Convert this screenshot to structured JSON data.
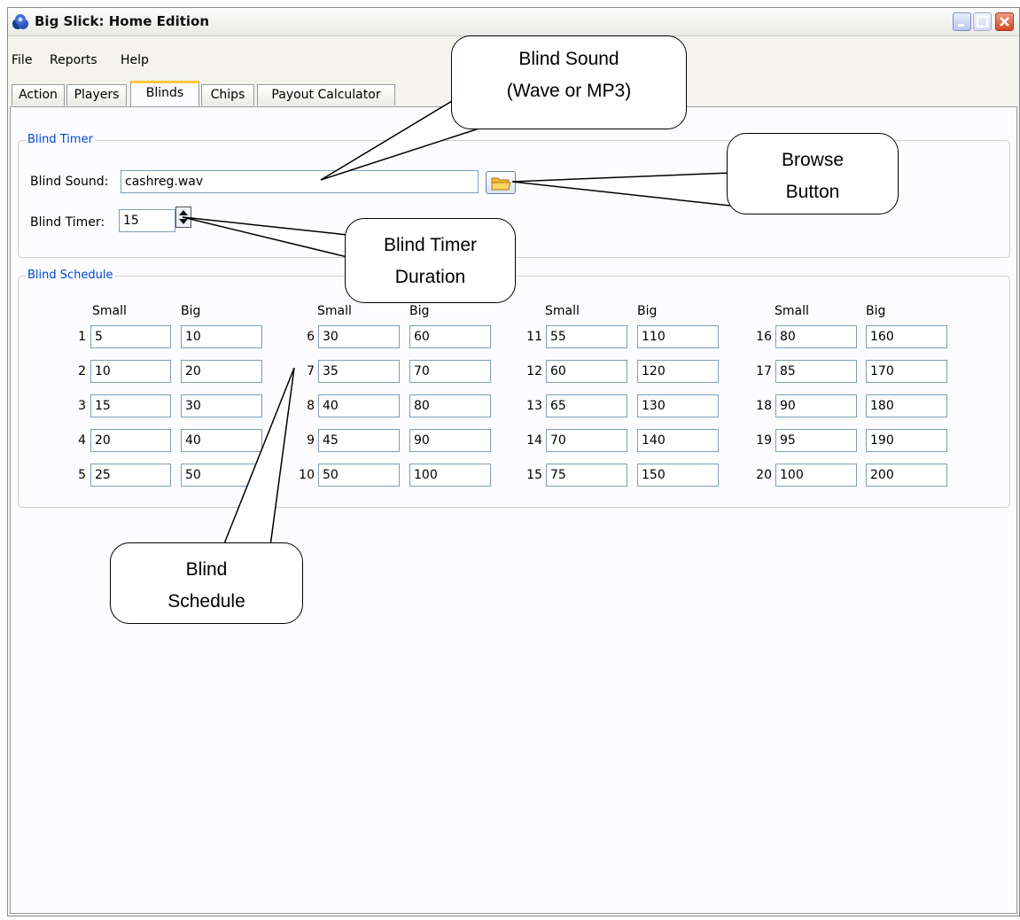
{
  "window": {
    "title": "Big Slick: Home Edition",
    "icon": "poker-chips-icon",
    "controls": [
      "minimize-icon",
      "maximize-icon",
      "close-icon"
    ]
  },
  "menu": {
    "file": "File",
    "reports": "Reports",
    "help": "Help"
  },
  "tabs": {
    "action": "Action",
    "players": "Players",
    "blinds": "Blinds",
    "chips": "Chips",
    "payout": "Payout Calculator",
    "active": "Blinds"
  },
  "blind_timer": {
    "legend": "Blind Timer",
    "sound_label": "Blind Sound:",
    "sound_value": "cashreg.wav",
    "timer_label": "Blind Timer:",
    "timer_value": "15",
    "browse_icon": "folder-icon"
  },
  "blind_schedule": {
    "legend": "Blind Schedule",
    "small_header": "Small",
    "big_header": "Big",
    "levels": [
      {
        "n": "1",
        "small": "5",
        "big": "10"
      },
      {
        "n": "2",
        "small": "10",
        "big": "20"
      },
      {
        "n": "3",
        "small": "15",
        "big": "30"
      },
      {
        "n": "4",
        "small": "20",
        "big": "40"
      },
      {
        "n": "5",
        "small": "25",
        "big": "50"
      },
      {
        "n": "6",
        "small": "30",
        "big": "60"
      },
      {
        "n": "7",
        "small": "35",
        "big": "70"
      },
      {
        "n": "8",
        "small": "40",
        "big": "80"
      },
      {
        "n": "9",
        "small": "45",
        "big": "90"
      },
      {
        "n": "10",
        "small": "50",
        "big": "100"
      },
      {
        "n": "11",
        "small": "55",
        "big": "110"
      },
      {
        "n": "12",
        "small": "60",
        "big": "120"
      },
      {
        "n": "13",
        "small": "65",
        "big": "130"
      },
      {
        "n": "14",
        "small": "70",
        "big": "140"
      },
      {
        "n": "15",
        "small": "75",
        "big": "150"
      },
      {
        "n": "16",
        "small": "80",
        "big": "160"
      },
      {
        "n": "17",
        "small": "85",
        "big": "170"
      },
      {
        "n": "18",
        "small": "90",
        "big": "180"
      },
      {
        "n": "19",
        "small": "95",
        "big": "190"
      },
      {
        "n": "20",
        "small": "100",
        "big": "200"
      }
    ]
  },
  "callouts": {
    "sound": {
      "line1": "Blind Sound",
      "line2": "(Wave or MP3)"
    },
    "browse": {
      "line1": "Browse",
      "line2": "Button"
    },
    "timer": {
      "line1": "Blind Timer",
      "line2": "Duration"
    },
    "schedule": {
      "line1": "Blind",
      "line2": "Schedule"
    }
  },
  "colors": {
    "legend": "#0046d5",
    "field_border": "#7f9db9",
    "tab_highlight": "#ffc83c"
  }
}
